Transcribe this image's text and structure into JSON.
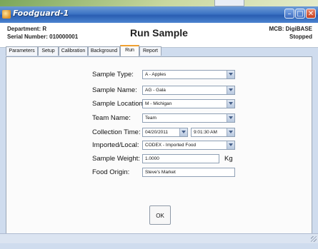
{
  "window": {
    "title": "Foodguard-1"
  },
  "header": {
    "department": "Department: R",
    "serial": "Serial Number: 010000001",
    "title": "Run Sample",
    "mcb": "MCB: DigiBASE",
    "status": "Stopped"
  },
  "tabs": [
    "Parameters",
    "Setup",
    "Calibration",
    "Background",
    "Run",
    "Report"
  ],
  "active_tab": "Run",
  "form": {
    "sample_type": {
      "label": "Sample Type:",
      "value": "A - Apples"
    },
    "sample_name": {
      "label": "Sample Name:",
      "value": "AG - Gala"
    },
    "sample_location": {
      "label": "Sample Location:",
      "value": "M - Michigan"
    },
    "team_name": {
      "label": "Team Name:",
      "value": "Team"
    },
    "collection_time": {
      "label": "Collection Time:",
      "date": "04/20/2011",
      "time": "9:01:30 AM"
    },
    "imported_local": {
      "label": "Imported/Local:",
      "value": "CODEX - Imported Food"
    },
    "sample_weight": {
      "label": "Sample Weight:",
      "value": "1.0000",
      "unit": "Kg"
    },
    "food_origin": {
      "label": "Food Origin:",
      "value": "Steve's Market"
    }
  },
  "buttons": {
    "ok": "OK"
  }
}
